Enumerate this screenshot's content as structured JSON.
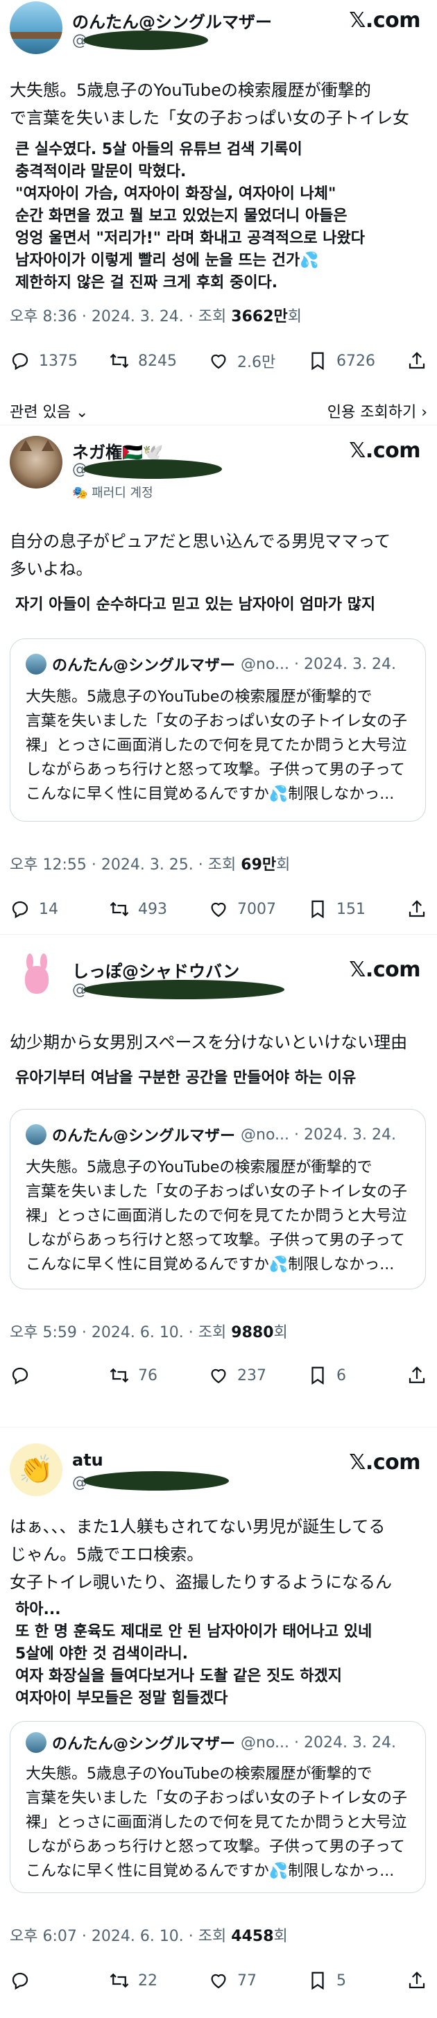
{
  "colors": {
    "text": "#0f1419",
    "secondary": "#536471",
    "border": "#cfd9de",
    "redaction": "#1d3a1f"
  },
  "tweets": [
    {
      "author": "のんたん@シングルマザー",
      "handle": "@",
      "text": "大失態。5歳息子のYouTubeの検索履歴が衝撃的\nで言葉を失いました「女の子おっぱい女の子トイレ女",
      "translation": "큰 실수였다. 5살 아들의 유튜브 검색 기록이\n충격적이라 말문이 막혔다.\n\"여자아이 가슴, 여자아이 화장실, 여자아이 나체\"\n순간 화면을 껐고 뭘 보고 있었는지 물었더니 아들은\n엉엉 울면서 \"저리가!\" 라며 화내고 공격적으로 나왔다\n남자아이가 이렇게 빨리 성에 눈을 뜨는 건가💦\n제한하지 않은 걸 진짜 크게 후회 중이다.",
      "time": "오후 8:36 · 2024. 3. 24. · 조회 ",
      "views": "3662만",
      "views_suffix": "회",
      "replies": "1375",
      "retweets": "8245",
      "likes": "2.6만",
      "bookmarks": "6726"
    },
    {
      "author": "ネガ権🇵🇸🕊️",
      "handle": "@",
      "badge": "패러디 계정",
      "text": "自分の息子がピュアだと思い込んでる男児ママって\n多いよね。",
      "translation": "자기 아들이 순수하다고 믿고 있는 남자아이 엄마가 많지",
      "time": "오후 12:55 · 2024. 3. 25. · 조회 ",
      "views": "69만",
      "views_suffix": "회",
      "replies": "14",
      "retweets": "493",
      "likes": "7007",
      "bookmarks": "151"
    },
    {
      "author": "しっぽ@シャドウバン",
      "handle": "@",
      "text": "幼少期から女男別スペースを分けないといけない理由",
      "translation": "유아기부터 여남을 구분한 공간을 만들어야 하는 이유",
      "time": "오후 5:59 · 2024. 6. 10. · 조회 ",
      "views": "9880",
      "views_suffix": "회",
      "replies": "",
      "retweets": "76",
      "likes": "237",
      "bookmarks": "6"
    },
    {
      "author": "atu",
      "handle": "@",
      "text": "はぁ、、、また1人躾もされてない男児が誕生してる\nじゃん。5歳でエロ検索。\n女子トイレ覗いたり、盗撮したりするようになるん",
      "translation": "하아...\n또 한 명 훈육도 제대로 안 된 남자아이가 태어나고 있네\n5살에 야한 것 검색이라니.\n여자 화장실을 들여다보거나 도촬 같은 짓도 하겠지\n여자아이 부모들은 정말 힘들겠다",
      "time": "오후 6:07 · 2024. 6. 10. · 조회 ",
      "views": "4458",
      "views_suffix": "회",
      "replies": "",
      "retweets": "22",
      "likes": "77",
      "bookmarks": "5"
    }
  ],
  "brand": "𝕏.com",
  "related_label": "관련 있음 ⌄",
  "quotes_label": "인용 조회하기 ›",
  "quote": {
    "author": "のんたん@シングルマザー",
    "handle": "@no... · 2024. 3. 24.",
    "text": "大失態。5歳息子のYouTubeの検索履歴が衝撃的で\n言葉を失いました「女の子おっぱい女の子トイレ女の子\n裸」とっさに画面消したので何を見てたか問うと大号泣\nしながらあっち行けと怒って攻撃。子供って男の子って\nこんなに早く性に目覚めるんですか💦制限しなかっ..."
  }
}
